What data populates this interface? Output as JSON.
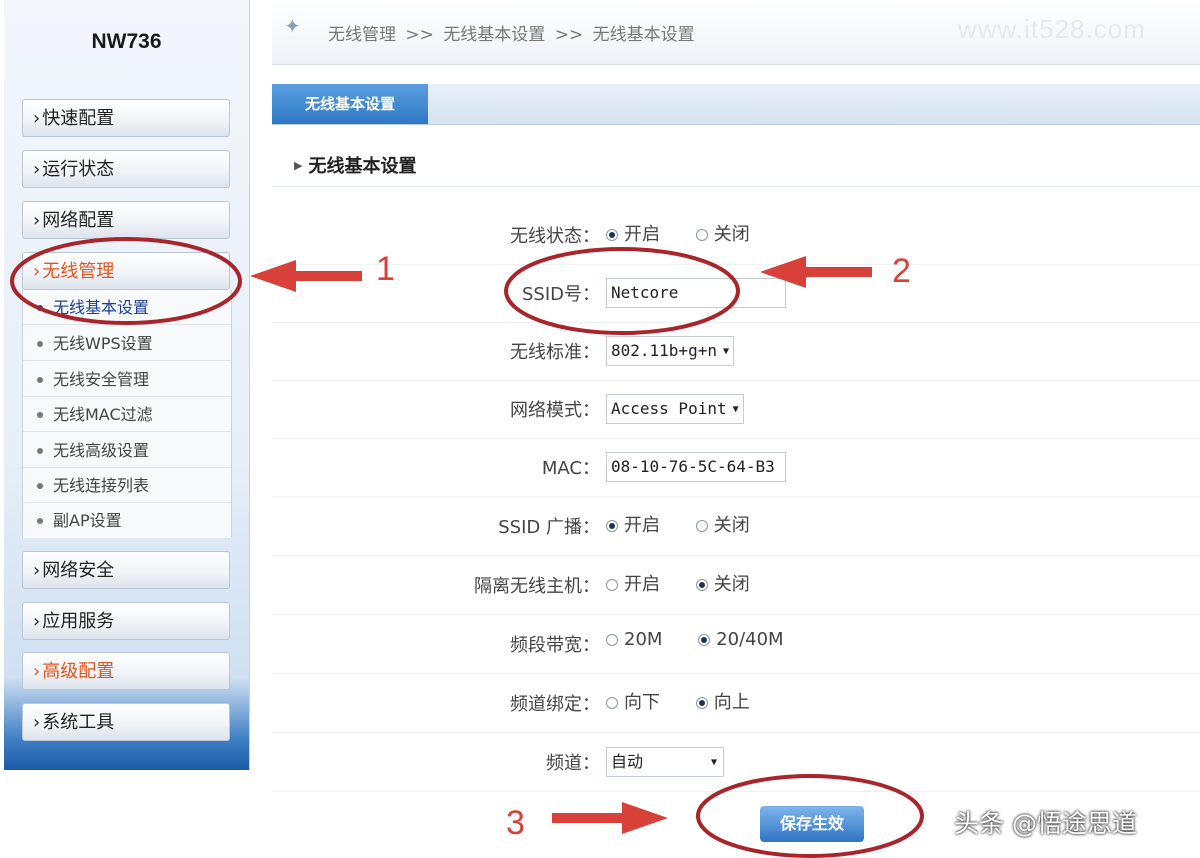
{
  "sidebar": {
    "model": "NW736",
    "menu": [
      {
        "label": "快速配置"
      },
      {
        "label": "运行状态"
      },
      {
        "label": "网络配置"
      },
      {
        "label": "无线管理"
      },
      {
        "label": "网络安全"
      },
      {
        "label": "应用服务"
      },
      {
        "label": "高级配置"
      },
      {
        "label": "系统工具"
      }
    ],
    "submenu": [
      {
        "label": "无线基本设置"
      },
      {
        "label": "无线WPS设置"
      },
      {
        "label": "无线安全管理"
      },
      {
        "label": "无线MAC过滤"
      },
      {
        "label": "无线高级设置"
      },
      {
        "label": "无线连接列表"
      },
      {
        "label": "副AP设置"
      }
    ],
    "chevron": "›"
  },
  "breadcrumb": {
    "items": [
      "无线管理",
      ">>",
      "无线基本设置",
      ">>",
      "无线基本设置"
    ],
    "icon": "sparkle-icon"
  },
  "watermark_top": "www.it528.com",
  "tab": {
    "label": "无线基本设置"
  },
  "section_title": "无线基本设置",
  "form": {
    "wireless_status": {
      "label": "无线状态：",
      "on": "开启",
      "off": "关闭",
      "selected": "on"
    },
    "ssid": {
      "label": "SSID号：",
      "value": "Netcore"
    },
    "standard": {
      "label": "无线标准：",
      "value": "802.11b+g+n"
    },
    "mode": {
      "label": "网络模式：",
      "value": "Access Point"
    },
    "mac": {
      "label": "MAC：",
      "value": "08-10-76-5C-64-B3"
    },
    "ssid_broadcast": {
      "label": "SSID 广播：",
      "on": "开启",
      "off": "关闭",
      "selected": "on"
    },
    "isolate": {
      "label": "隔离无线主机：",
      "on": "开启",
      "off": "关闭",
      "selected": "off"
    },
    "bandwidth": {
      "label": "频段带宽：",
      "opt1": "20M",
      "opt2": "20/40M",
      "selected": "opt2"
    },
    "channel_bind": {
      "label": "频道绑定：",
      "opt1": "向下",
      "opt2": "向上",
      "selected": "opt2"
    },
    "channel": {
      "label": "频道：",
      "value": "自动"
    }
  },
  "save_button": "保存生效",
  "annotations": {
    "one": "1",
    "two": "2",
    "three": "3",
    "color": "#d8403a",
    "circle_color": "#a8252b"
  },
  "watermark_bottom": "头条 @悟途思道"
}
